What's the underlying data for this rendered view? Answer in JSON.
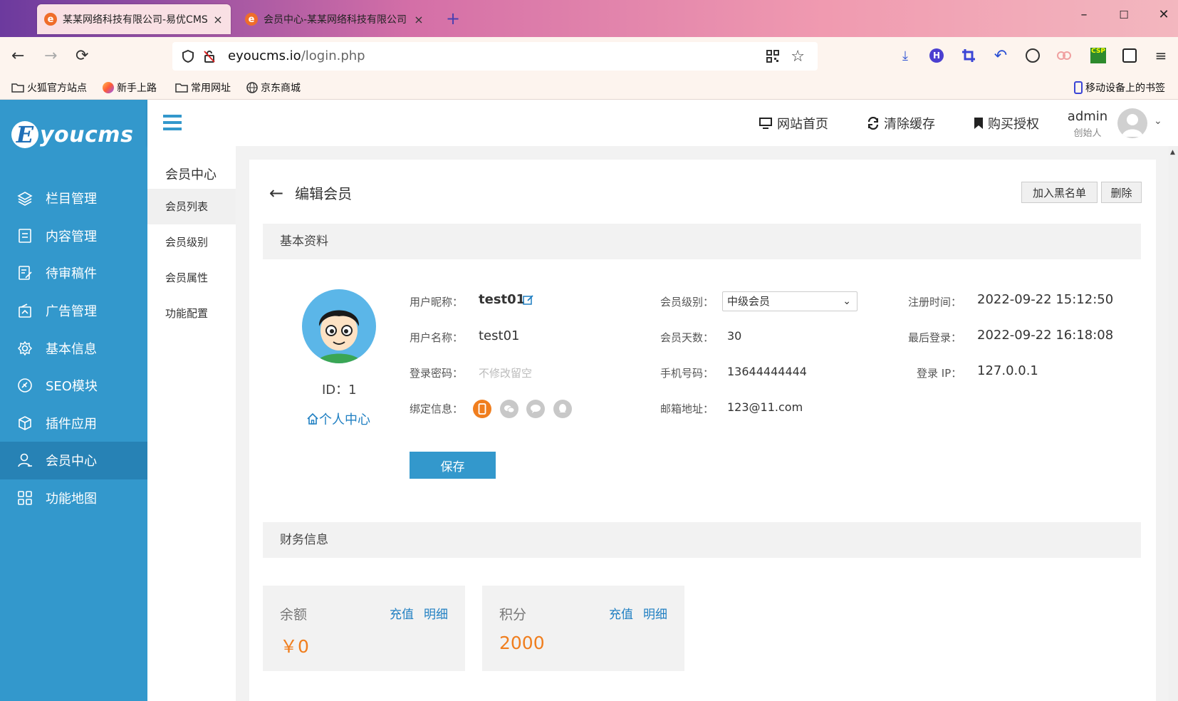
{
  "browser": {
    "tabs": [
      {
        "title": "某某网络科技有限公司-易优CMS",
        "active": true
      },
      {
        "title": "会员中心-某某网络科技有限公司",
        "active": false
      }
    ],
    "new_tab": "+",
    "url": {
      "host": "eyoucms.io",
      "path": "/login.php"
    },
    "bookmarks": [
      "火狐官方站点",
      "新手上路",
      "常用网址",
      "京东商城"
    ],
    "mobile_bookmarks": "移动设备上的书签",
    "window_controls": {
      "minimize": "–",
      "maximize": "☐",
      "close": "✕"
    }
  },
  "sidebar": {
    "logo_letter": "E",
    "logo_text": "youcms",
    "items": [
      {
        "label": "栏目管理",
        "icon": "layers-icon"
      },
      {
        "label": "内容管理",
        "icon": "document-icon"
      },
      {
        "label": "待审稿件",
        "icon": "review-icon"
      },
      {
        "label": "广告管理",
        "icon": "ad-icon"
      },
      {
        "label": "基本信息",
        "icon": "gear-icon"
      },
      {
        "label": "SEO模块",
        "icon": "seo-icon"
      },
      {
        "label": "插件应用",
        "icon": "cube-icon"
      },
      {
        "label": "会员中心",
        "icon": "user-icon",
        "active": true
      },
      {
        "label": "功能地图",
        "icon": "grid-icon"
      }
    ]
  },
  "subnav": {
    "title": "会员中心",
    "items": [
      "会员列表",
      "会员级别",
      "会员属性",
      "功能配置"
    ],
    "active_index": 0
  },
  "header": {
    "links": [
      "网站首页",
      "清除缓存",
      "购买授权"
    ],
    "user_name": "admin",
    "user_role": "创始人"
  },
  "page": {
    "title": "编辑会员",
    "actions": [
      "加入黑名单",
      "删除"
    ],
    "basic_section": "基本资料",
    "finance_section": "财务信息"
  },
  "member": {
    "id_label": "ID：1",
    "personal_center": "个人中心",
    "nickname_label": "用户昵称：",
    "nickname": "test01",
    "username_label": "用户名称：",
    "username": "test01",
    "password_label": "登录密码：",
    "password_placeholder": "不修改留空",
    "bind_label": "绑定信息：",
    "level_label": "会员级别：",
    "level": "中级会员",
    "days_label": "会员天数：",
    "days": "30",
    "phone_label": "手机号码：",
    "phone": "13644444444",
    "email_label": "邮箱地址：",
    "email": "123@11.com",
    "reg_time_label": "注册时间：",
    "reg_time": "2022-09-22 15:12:50",
    "last_login_label": "最后登录：",
    "last_login": "2022-09-22 16:18:08",
    "login_ip_label": "登录 IP：",
    "login_ip": "127.0.0.1",
    "save": "保存"
  },
  "finance": [
    {
      "label": "余额",
      "value": "￥0",
      "recharge": "充值",
      "detail": "明细"
    },
    {
      "label": "积分",
      "value": "2000",
      "recharge": "充值",
      "detail": "明细"
    }
  ],
  "colors": {
    "primary": "#3398cc",
    "sidebar_active": "#2782b5",
    "accent_orange": "#f07e1e",
    "link_blue": "#1f7fc2"
  }
}
